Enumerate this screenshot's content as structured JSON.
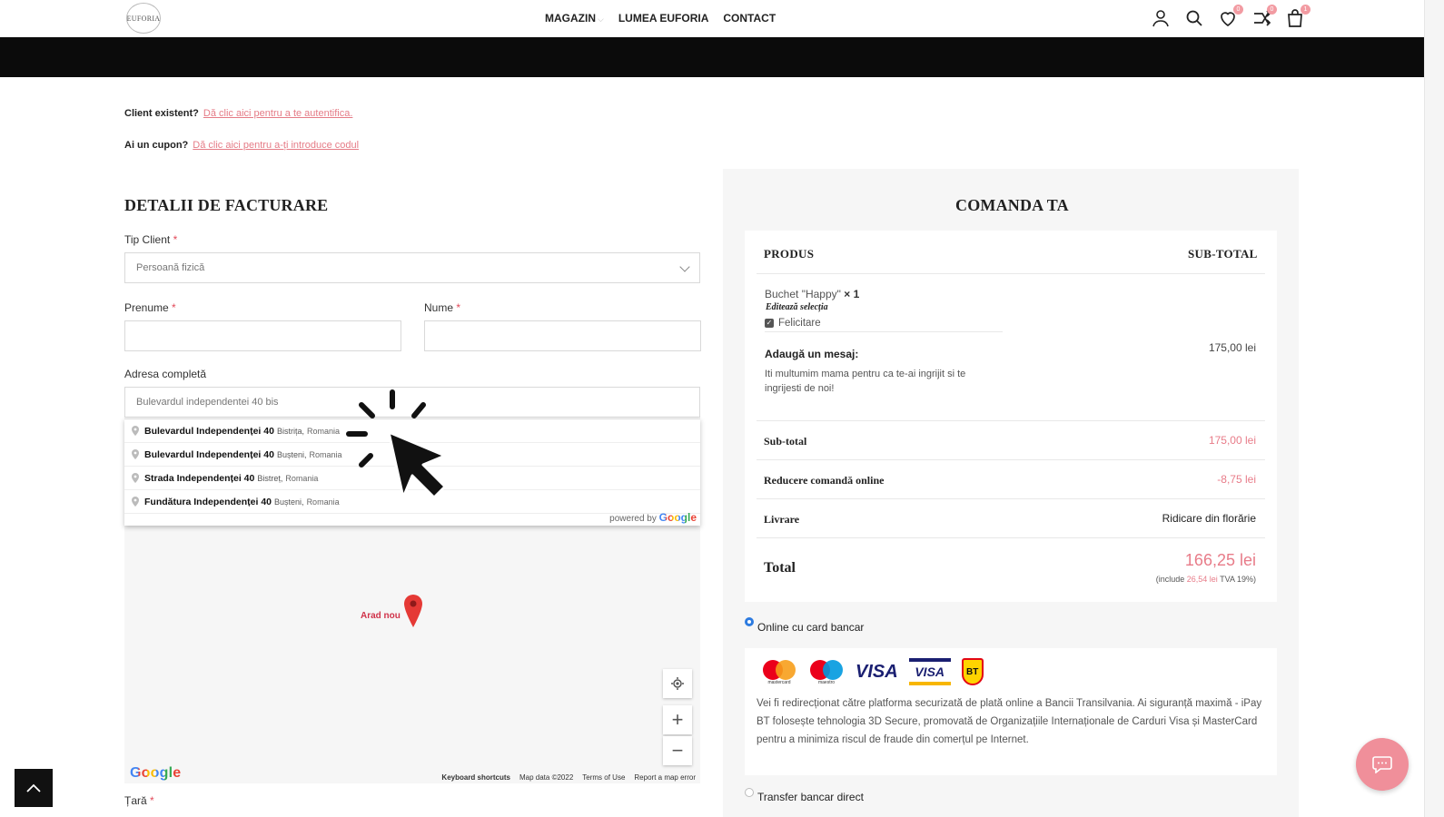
{
  "header": {
    "logo_text": "EUFORIA",
    "nav": [
      "MAGAZIN",
      "LUMEA EUFORIA",
      "CONTACT"
    ],
    "badges": {
      "wishlist": "0",
      "compare": "0",
      "cart": "1"
    }
  },
  "notices": {
    "returning_label": "Client existent?",
    "returning_link": "Dă clic aici pentru a te autentifica.",
    "coupon_label": "Ai un cupon?",
    "coupon_link": "Dă clic aici pentru a-ți introduce codul"
  },
  "billing": {
    "title": "DETALII DE FACTURARE",
    "client_type_label": "Tip Client",
    "client_type_value": "Persoană fizică",
    "first_name_label": "Prenume",
    "last_name_label": "Nume",
    "address_label": "Adresa completă",
    "address_value": "Bulevardul independentei 40 bis",
    "country_label": "Țară",
    "required_mark": "*"
  },
  "autocomplete": {
    "suggestions": [
      {
        "street": "Bulevardul Independenței 40",
        "city": "Bistrița,",
        "country": "Romania"
      },
      {
        "street": "Bulevardul Independenței 40",
        "city": "Bușteni,",
        "country": "Romania"
      },
      {
        "street": "Strada Independenței 40",
        "city": "Bistreț,",
        "country": "Romania"
      },
      {
        "street": "Fundătura Independenței 40",
        "city": "Bușteni,",
        "country": "Romania"
      }
    ],
    "powered_by": "powered by",
    "google": "Google"
  },
  "map": {
    "marker_label": "Arad nou",
    "logo": "Google",
    "footer": [
      "Keyboard shortcuts",
      "Map data ©2022",
      "Terms of Use",
      "Report a map error"
    ]
  },
  "order": {
    "title": "COMANDA TA",
    "col_product": "PRODUS",
    "col_subtotal": "SUB-TOTAL",
    "product_name": "Buchet \"Happy\"",
    "product_qty": "× 1",
    "edit_selection": "Editează selecția",
    "addon": "Felicitare",
    "message_label": "Adaugă un mesaj:",
    "message_text": "Iti multumim mama pentru ca te-ai ingrijit si te ingrijesti de noi!",
    "product_price": "175,00 lei",
    "subtotal_label": "Sub-total",
    "subtotal_value": "175,00 lei",
    "discount_label": "Reducere comandă online",
    "discount_value": "-8,75 lei",
    "shipping_label": "Livrare",
    "shipping_value": "Ridicare din florărie",
    "total_label": "Total",
    "total_value": "166,25 lei",
    "tax_prefix": "(include",
    "tax_amount": "26,54 lei",
    "tax_suffix": "TVA 19%)"
  },
  "payment": {
    "card_option": "Online cu card bancar",
    "card_logos": [
      "mastercard",
      "maestro",
      "VISA",
      "VISA",
      "BT"
    ],
    "card_description": "Vei fi redirecționat către platforma securizată de plată online a Bancii Transilvania. Ai siguranță maximă - iPay BT folosește tehnologia 3D Secure, promovată de Organizațiile Internaționale de Carduri Visa și MasterCard pentru a minimiza riscul de fraude din comerțul pe Internet.",
    "transfer_option": "Transfer bancar direct"
  },
  "colors": {
    "accent": "#e87c89",
    "radio": "#2d7be0",
    "dark": "#0b0b0b"
  }
}
